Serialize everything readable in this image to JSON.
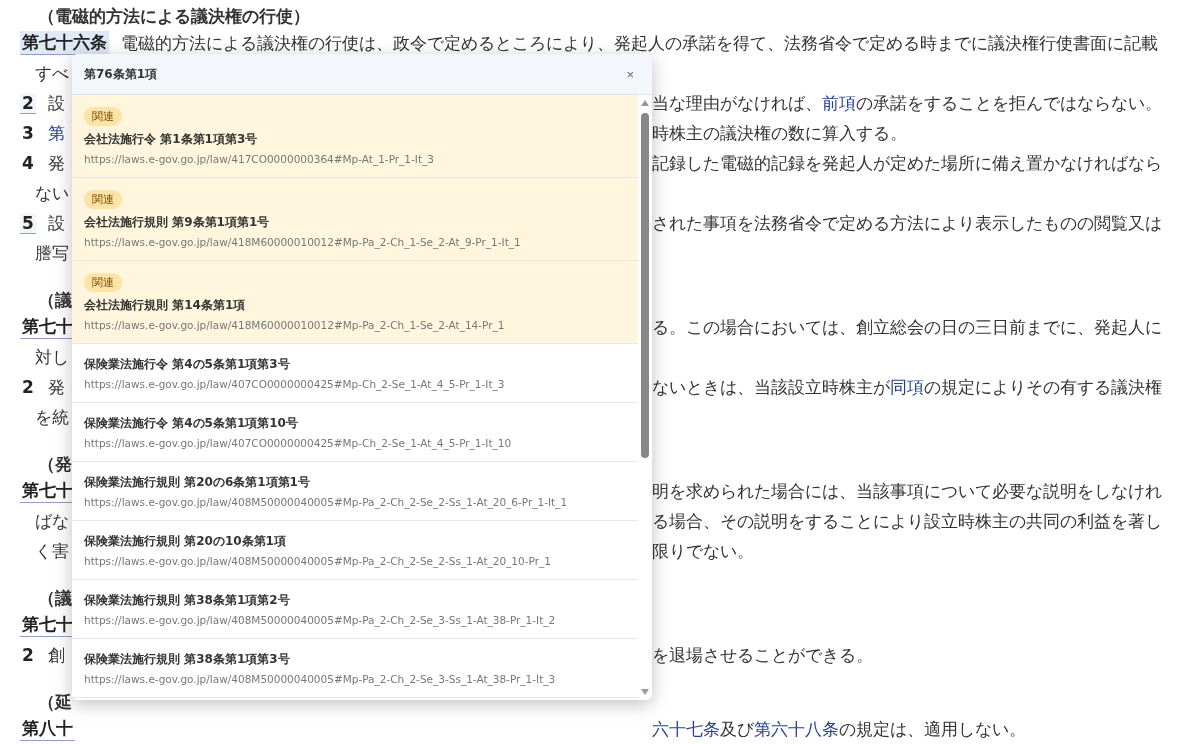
{
  "document": {
    "lines": [
      {
        "kind": "heading",
        "left": [
          {
            "kind": "text",
            "text": "（電磁的方法による議決権の行使）"
          }
        ]
      },
      {
        "kind": "full",
        "left": [
          {
            "kind": "article",
            "text": "第七十六条",
            "selected": true
          },
          {
            "kind": "text",
            "text": "電磁的方法による議決権の行使は、政令で定めるところにより、発起人の承諾を得て、法務省令で定める時までに議決権行使書面に記載"
          }
        ]
      },
      {
        "kind": "continuation",
        "left": [
          {
            "kind": "text",
            "text": "すべ"
          }
        ]
      },
      {
        "kind": "paragraph",
        "left": [
          {
            "kind": "number",
            "text": "2",
            "boxed": true
          },
          {
            "kind": "text",
            "text": "設"
          }
        ],
        "right": [
          {
            "text": "当な理由がなければ、",
            "link": false
          },
          {
            "text": "前項",
            "link": true
          },
          {
            "text": "の承諾をすることを拒んではならない。",
            "link": false
          }
        ]
      },
      {
        "kind": "paragraph",
        "left": [
          {
            "kind": "number",
            "text": "3",
            "boxed": false
          },
          {
            "kind": "link",
            "text": "第"
          }
        ],
        "right": [
          {
            "text": "時株主の議決権の数に算入する。",
            "link": false
          }
        ]
      },
      {
        "kind": "paragraph",
        "left": [
          {
            "kind": "number",
            "text": "4",
            "boxed": false
          },
          {
            "kind": "text",
            "text": "発"
          }
        ],
        "right": [
          {
            "text": "記録した電磁的記録を発起人が定めた場所に備え置かなければなら",
            "link": false
          }
        ]
      },
      {
        "kind": "continuation",
        "left": [
          {
            "kind": "text",
            "text": "ない"
          }
        ]
      },
      {
        "kind": "paragraph",
        "left": [
          {
            "kind": "number",
            "text": "5",
            "boxed": true
          },
          {
            "kind": "text",
            "text": "設"
          }
        ],
        "right": [
          {
            "text": "された事項を法務省令で定める方法により表示したものの閲覧又は",
            "link": false
          }
        ]
      },
      {
        "kind": "continuation",
        "left": [
          {
            "kind": "text",
            "text": "謄写"
          }
        ]
      },
      {
        "kind": "heading",
        "left": [
          {
            "kind": "text",
            "text": "（議"
          }
        ]
      },
      {
        "kind": "paragraph",
        "left": [
          {
            "kind": "article",
            "text": "第七十",
            "selected": false
          }
        ],
        "right": [
          {
            "text": "る。この場合においては、創立総会の日の三日前までに、発起人に",
            "link": false
          }
        ]
      },
      {
        "kind": "continuation",
        "left": [
          {
            "kind": "text",
            "text": "対し"
          }
        ]
      },
      {
        "kind": "paragraph",
        "left": [
          {
            "kind": "number",
            "text": "2",
            "boxed": false
          },
          {
            "kind": "text",
            "text": "発"
          }
        ],
        "right": [
          {
            "text": "ないときは、当該設立時株主が",
            "link": false
          },
          {
            "text": "同項",
            "link": true
          },
          {
            "text": "の規定によりその有する議決権",
            "link": false
          }
        ]
      },
      {
        "kind": "continuation",
        "left": [
          {
            "kind": "text",
            "text": "を統"
          }
        ]
      },
      {
        "kind": "heading",
        "left": [
          {
            "kind": "text",
            "text": "（発"
          }
        ]
      },
      {
        "kind": "paragraph",
        "left": [
          {
            "kind": "article",
            "text": "第七十",
            "selected": false
          }
        ],
        "right": [
          {
            "text": "明を求められた場合には、当該事項について必要な説明をしなけれ",
            "link": false
          }
        ]
      },
      {
        "kind": "continuation",
        "left": [
          {
            "kind": "text",
            "text": "ばな"
          }
        ],
        "right": [
          {
            "text": "る場合、その説明をすることにより設立時株主の共同の利益を著し",
            "link": false
          }
        ]
      },
      {
        "kind": "continuation",
        "left": [
          {
            "kind": "text",
            "text": "く害"
          }
        ],
        "right": [
          {
            "text": "限りでない。",
            "link": false
          }
        ]
      },
      {
        "kind": "heading",
        "left": [
          {
            "kind": "text",
            "text": "（議"
          }
        ]
      },
      {
        "kind": "paragraph",
        "left": [
          {
            "kind": "article",
            "text": "第七十",
            "selected": false
          }
        ]
      },
      {
        "kind": "paragraph",
        "left": [
          {
            "kind": "number",
            "text": "2",
            "boxed": false
          },
          {
            "kind": "text",
            "text": "創"
          }
        ],
        "right": [
          {
            "text": "を退場させることができる。",
            "link": false
          }
        ]
      },
      {
        "kind": "heading",
        "left": [
          {
            "kind": "text",
            "text": "（延"
          }
        ]
      },
      {
        "kind": "paragraph",
        "left": [
          {
            "kind": "article",
            "text": "第八十",
            "selected": false
          }
        ],
        "right": [
          {
            "text": "六十七条",
            "link": true
          },
          {
            "text": "及び",
            "link": false
          },
          {
            "text": "第六十八条",
            "link": true
          },
          {
            "text": "の規定は、適用しない。",
            "link": false
          }
        ]
      }
    ]
  },
  "popup": {
    "title": "第76条第1項",
    "close": "×",
    "items": [
      {
        "related": true,
        "badge": "関連",
        "title": "会社法施行令 第1条第1項第3号",
        "url": "https://laws.e-gov.go.jp/law/417CO0000000364#Mp-At_1-Pr_1-It_3"
      },
      {
        "related": true,
        "badge": "関連",
        "title": "会社法施行規則 第9条第1項第1号",
        "url": "https://laws.e-gov.go.jp/law/418M60000010012#Mp-Pa_2-Ch_1-Se_2-At_9-Pr_1-It_1"
      },
      {
        "related": true,
        "badge": "関連",
        "title": "会社法施行規則 第14条第1項",
        "url": "https://laws.e-gov.go.jp/law/418M60000010012#Mp-Pa_2-Ch_1-Se_2-At_14-Pr_1"
      },
      {
        "related": false,
        "title": "保険業法施行令 第4の5条第1項第3号",
        "url": "https://laws.e-gov.go.jp/law/407CO0000000425#Mp-Ch_2-Se_1-At_4_5-Pr_1-It_3"
      },
      {
        "related": false,
        "title": "保険業法施行令 第4の5条第1項第10号",
        "url": "https://laws.e-gov.go.jp/law/407CO0000000425#Mp-Ch_2-Se_1-At_4_5-Pr_1-It_10"
      },
      {
        "related": false,
        "title": "保険業法施行規則 第20の6条第1項第1号",
        "url": "https://laws.e-gov.go.jp/law/408M50000040005#Mp-Pa_2-Ch_2-Se_2-Ss_1-At_20_6-Pr_1-It_1"
      },
      {
        "related": false,
        "title": "保険業法施行規則 第20の10条第1項",
        "url": "https://laws.e-gov.go.jp/law/408M50000040005#Mp-Pa_2-Ch_2-Se_2-Ss_1-At_20_10-Pr_1"
      },
      {
        "related": false,
        "title": "保険業法施行規則 第38条第1項第2号",
        "url": "https://laws.e-gov.go.jp/law/408M50000040005#Mp-Pa_2-Ch_2-Se_3-Ss_1-At_38-Pr_1-It_2"
      },
      {
        "related": false,
        "title": "保険業法施行規則 第38条第1項第3号",
        "url": "https://laws.e-gov.go.jp/law/408M50000040005#Mp-Pa_2-Ch_2-Se_3-Ss_1-At_38-Pr_1-It_3"
      }
    ]
  }
}
